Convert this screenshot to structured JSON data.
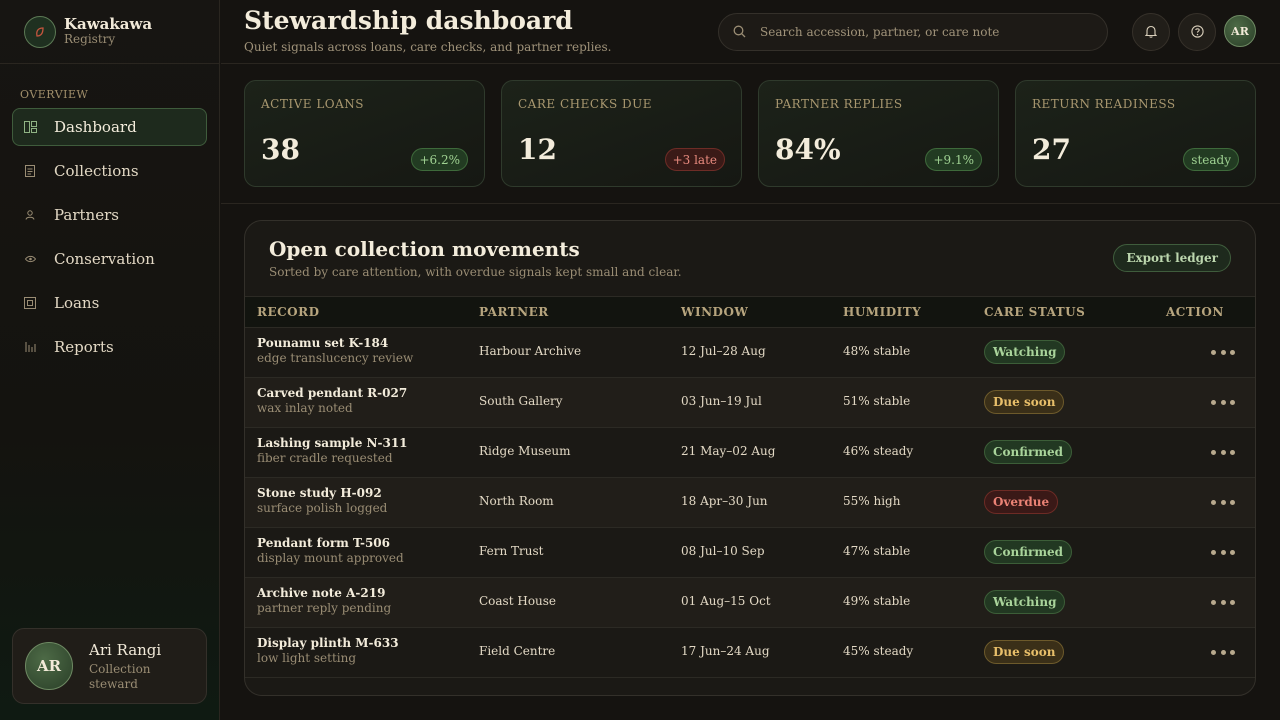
{
  "brand": {
    "name": "Kawakawa",
    "sub": "Registry"
  },
  "nav": {
    "heading": "OVERVIEW",
    "items": [
      {
        "label": "Dashboard",
        "icon": "dashboard-icon",
        "active": true
      },
      {
        "label": "Collections",
        "icon": "document-icon",
        "active": false
      },
      {
        "label": "Partners",
        "icon": "person-icon",
        "active": false
      },
      {
        "label": "Conservation",
        "icon": "eye-icon",
        "active": false
      },
      {
        "label": "Loans",
        "icon": "box-icon",
        "active": false
      },
      {
        "label": "Reports",
        "icon": "bar-chart-icon",
        "active": false
      }
    ]
  },
  "user": {
    "initials": "AR",
    "name": "Ari Rangi",
    "role": "Collection steward"
  },
  "header": {
    "title": "Stewardship dashboard",
    "subtitle": "Quiet signals across loans, care checks, and partner replies.",
    "search_placeholder": "Search accession, partner, or care note",
    "avatar_initials": "AR"
  },
  "stats": [
    {
      "label": "ACTIVE LOANS",
      "value": "38",
      "pill": "+6.2%",
      "tone": "green"
    },
    {
      "label": "CARE CHECKS DUE",
      "value": "12",
      "pill": "+3 late",
      "tone": "red"
    },
    {
      "label": "PARTNER REPLIES",
      "value": "84%",
      "pill": "+9.1%",
      "tone": "green"
    },
    {
      "label": "RETURN READINESS",
      "value": "27",
      "pill": "steady",
      "tone": "green"
    }
  ],
  "panel": {
    "title": "Open collection movements",
    "subtitle": "Sorted by care attention, with overdue signals kept small and clear.",
    "export_label": "Export ledger",
    "columns": [
      "RECORD",
      "PARTNER",
      "WINDOW",
      "HUMIDITY",
      "CARE STATUS",
      "ACTION"
    ],
    "rows": [
      {
        "title": "Pounamu set K-184",
        "note": "edge translucency review",
        "partner": "Harbour Archive",
        "window": "12 Jul–28 Aug",
        "humidity": "48% stable",
        "status": "Watching",
        "tone": "watching"
      },
      {
        "title": "Carved pendant R-027",
        "note": "wax inlay noted",
        "partner": "South Gallery",
        "window": "03 Jun–19 Jul",
        "humidity": "51% stable",
        "status": "Due soon",
        "tone": "due"
      },
      {
        "title": "Lashing sample N-311",
        "note": "fiber cradle requested",
        "partner": "Ridge Museum",
        "window": "21 May–02 Aug",
        "humidity": "46% steady",
        "status": "Confirmed",
        "tone": "confirmed"
      },
      {
        "title": "Stone study H-092",
        "note": "surface polish logged",
        "partner": "North Room",
        "window": "18 Apr–30 Jun",
        "humidity": "55% high",
        "status": "Overdue",
        "tone": "overdue"
      },
      {
        "title": "Pendant form T-506",
        "note": "display mount approved",
        "partner": "Fern Trust",
        "window": "08 Jul–10 Sep",
        "humidity": "47% stable",
        "status": "Confirmed",
        "tone": "confirmed"
      },
      {
        "title": "Archive note A-219",
        "note": "partner reply pending",
        "partner": "Coast House",
        "window": "01 Aug–15 Oct",
        "humidity": "49% stable",
        "status": "Watching",
        "tone": "watching"
      },
      {
        "title": "Display plinth M-633",
        "note": "low light setting",
        "partner": "Field Centre",
        "window": "17 Jun–24 Aug",
        "humidity": "45% steady",
        "status": "Due soon",
        "tone": "due"
      }
    ]
  }
}
